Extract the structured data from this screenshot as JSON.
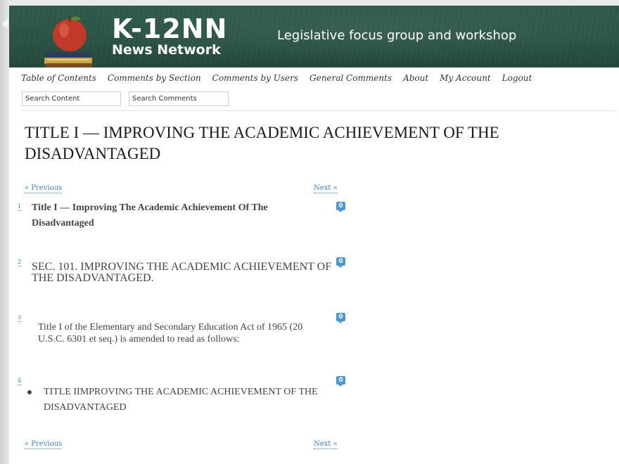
{
  "header": {
    "brand_mark": "K-12NN",
    "brand_sub": "News Network",
    "tagline": "Legislative focus group and workshop",
    "color": "#2a5244"
  },
  "nav": {
    "items": [
      {
        "label": "Table of Contents"
      },
      {
        "label": "Comments by Section"
      },
      {
        "label": "Comments by Users"
      },
      {
        "label": "General Comments"
      },
      {
        "label": "About"
      },
      {
        "label": "My Account"
      },
      {
        "label": "Logout"
      }
    ]
  },
  "search": {
    "content_placeholder": "Search Content",
    "comments_placeholder": "Search Comments"
  },
  "page": {
    "title": "TITLE I — IMPROVING THE ACADEMIC ACHIEVEMENT OF THE DISADVANTAGED"
  },
  "pager": {
    "previous": "« Previous",
    "next": "Next »"
  },
  "paragraphs": [
    {
      "number": "1",
      "text": "Title I — Improving The Academic Achievement Of The Disadvantaged",
      "comments": "0"
    },
    {
      "number": "2",
      "text": "SEC. 101. IMPROVING THE ACADEMIC ACHIEVEMENT OF THE DISADVANTAGED.",
      "comments": "0"
    },
    {
      "number": "3",
      "text": "Title I of the Elementary and Secondary Education Act of 1965 (20 U.S.C. 6301 et seq.) is amended to read as follows:",
      "comments": "0"
    },
    {
      "number": "4",
      "text": "TITLE IIMPROVING THE ACADEMIC ACHIEVEMENT OF THE DISADVANTAGED",
      "comments": "0"
    }
  ],
  "colors": {
    "link": "#3b7fc4",
    "badge": "#4a97d4"
  }
}
